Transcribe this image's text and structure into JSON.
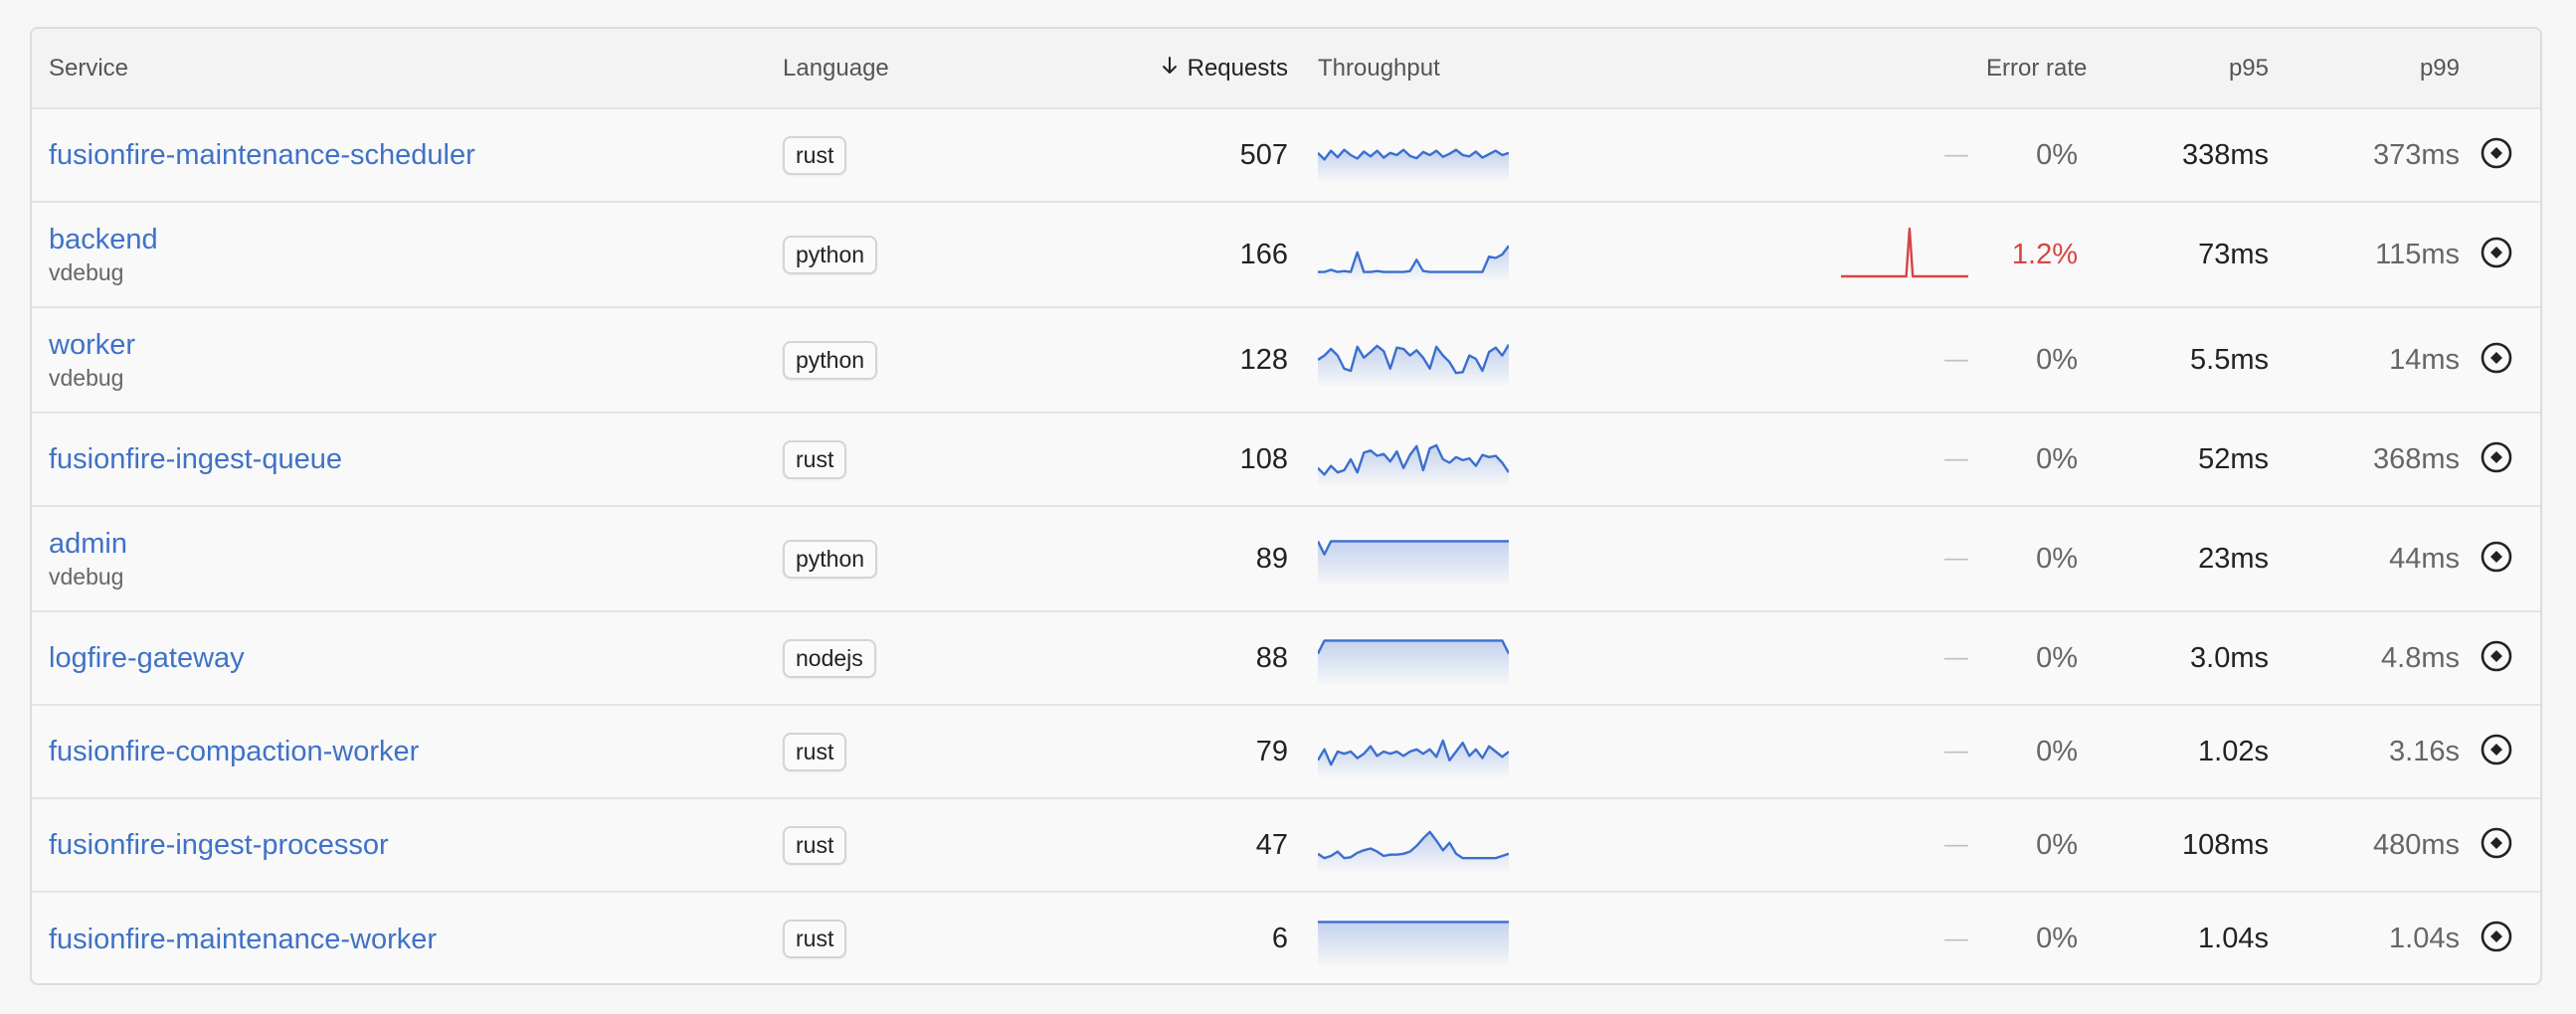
{
  "table": {
    "headers": {
      "service": "Service",
      "language": "Language",
      "requests": "Requests",
      "throughput": "Throughput",
      "error_rate": "Error rate",
      "p95": "p95",
      "p99": "p99"
    },
    "sort": {
      "column": "requests",
      "direction": "descending",
      "icon": "arrow-down-icon"
    },
    "colors": {
      "link": "#3f72c7",
      "sparkline": "#3b6fd0",
      "error": "#d64545"
    },
    "rows": [
      {
        "service": "fusionfire-maintenance-scheduler",
        "sub": "",
        "language": "rust",
        "requests": "507",
        "throughput": [
          0.55,
          0.4,
          0.6,
          0.45,
          0.62,
          0.5,
          0.42,
          0.58,
          0.47,
          0.6,
          0.44,
          0.55,
          0.5,
          0.62,
          0.48,
          0.43,
          0.57,
          0.5,
          0.6,
          0.46,
          0.53,
          0.62,
          0.5,
          0.47,
          0.58,
          0.44,
          0.52,
          0.6,
          0.5,
          0.55
        ],
        "error_rate": "0%",
        "error_spark": null,
        "p95": "338ms",
        "p99": "373ms"
      },
      {
        "service": "backend",
        "sub": "vdebug",
        "language": "python",
        "requests": "166",
        "throughput": [
          0.1,
          0.1,
          0.15,
          0.1,
          0.12,
          0.1,
          0.55,
          0.1,
          0.1,
          0.12,
          0.1,
          0.1,
          0.1,
          0.1,
          0.12,
          0.38,
          0.12,
          0.1,
          0.1,
          0.1,
          0.1,
          0.1,
          0.1,
          0.1,
          0.1,
          0.1,
          0.45,
          0.42,
          0.5,
          0.7
        ],
        "error_rate": "1.2%",
        "error_spark": [
          0,
          0,
          0,
          0,
          0,
          0,
          0,
          0,
          0,
          0,
          0,
          0,
          0,
          0,
          0,
          0,
          0,
          0,
          0,
          0,
          0,
          1,
          0,
          0,
          0,
          0,
          0,
          0,
          0,
          0,
          0,
          0,
          0,
          0,
          0,
          0,
          0,
          0,
          0,
          0
        ],
        "p95": "73ms",
        "p99": "115ms"
      },
      {
        "service": "worker",
        "sub": "vdebug",
        "language": "python",
        "requests": "128",
        "throughput": [
          0.5,
          0.6,
          0.75,
          0.6,
          0.3,
          0.25,
          0.8,
          0.55,
          0.68,
          0.82,
          0.7,
          0.3,
          0.78,
          0.75,
          0.6,
          0.72,
          0.55,
          0.3,
          0.8,
          0.6,
          0.45,
          0.2,
          0.22,
          0.6,
          0.52,
          0.25,
          0.68,
          0.78,
          0.6,
          0.85
        ],
        "error_rate": "0%",
        "error_spark": null,
        "p95": "5.5ms",
        "p99": "14ms"
      },
      {
        "service": "fusionfire-ingest-queue",
        "sub": "",
        "language": "rust",
        "requests": "108",
        "throughput": [
          0.3,
          0.15,
          0.35,
          0.2,
          0.25,
          0.5,
          0.2,
          0.65,
          0.7,
          0.58,
          0.62,
          0.45,
          0.68,
          0.3,
          0.6,
          0.8,
          0.25,
          0.75,
          0.82,
          0.5,
          0.42,
          0.55,
          0.48,
          0.52,
          0.35,
          0.6,
          0.55,
          0.58,
          0.42,
          0.2
        ],
        "error_rate": "0%",
        "error_spark": null,
        "p95": "52ms",
        "p99": "368ms"
      },
      {
        "service": "admin",
        "sub": "vdebug",
        "language": "python",
        "requests": "89",
        "throughput": [
          0.9,
          0.6,
          0.9,
          0.9,
          0.9,
          0.9,
          0.9,
          0.9,
          0.9,
          0.9,
          0.9,
          0.9,
          0.9,
          0.9,
          0.9,
          0.9,
          0.9,
          0.9,
          0.9,
          0.9,
          0.9,
          0.9,
          0.9,
          0.9,
          0.9,
          0.9,
          0.9,
          0.9,
          0.9,
          0.9
        ],
        "error_rate": "0%",
        "error_spark": null,
        "p95": "23ms",
        "p99": "44ms"
      },
      {
        "service": "logfire-gateway",
        "sub": "",
        "language": "nodejs",
        "requests": "88",
        "throughput": [
          0.6,
          0.9,
          0.9,
          0.9,
          0.9,
          0.9,
          0.9,
          0.9,
          0.9,
          0.9,
          0.9,
          0.9,
          0.9,
          0.9,
          0.9,
          0.9,
          0.9,
          0.9,
          0.9,
          0.9,
          0.9,
          0.9,
          0.9,
          0.9,
          0.9,
          0.9,
          0.9,
          0.9,
          0.9,
          0.6
        ],
        "error_rate": "0%",
        "error_spark": null,
        "p95": "3.0ms",
        "p99": "4.8ms"
      },
      {
        "service": "fusionfire-compaction-worker",
        "sub": "",
        "language": "rust",
        "requests": "79",
        "throughput": [
          0.3,
          0.55,
          0.2,
          0.5,
          0.45,
          0.5,
          0.35,
          0.45,
          0.62,
          0.4,
          0.5,
          0.45,
          0.5,
          0.4,
          0.5,
          0.55,
          0.45,
          0.55,
          0.38,
          0.75,
          0.3,
          0.5,
          0.7,
          0.4,
          0.55,
          0.35,
          0.62,
          0.5,
          0.38,
          0.5
        ],
        "error_rate": "0%",
        "error_spark": null,
        "p95": "1.02s",
        "p99": "3.16s"
      },
      {
        "service": "fusionfire-ingest-processor",
        "sub": "",
        "language": "rust",
        "requests": "47",
        "throughput": [
          0.3,
          0.2,
          0.25,
          0.35,
          0.2,
          0.22,
          0.32,
          0.38,
          0.42,
          0.35,
          0.25,
          0.28,
          0.28,
          0.3,
          0.35,
          0.48,
          0.65,
          0.8,
          0.6,
          0.38,
          0.55,
          0.3,
          0.2,
          0.2,
          0.2,
          0.2,
          0.2,
          0.2,
          0.25,
          0.3
        ],
        "error_rate": "0%",
        "error_spark": null,
        "p95": "108ms",
        "p99": "480ms"
      },
      {
        "service": "fusionfire-maintenance-worker",
        "sub": "",
        "language": "rust",
        "requests": "6",
        "throughput": [
          0.9,
          0.9,
          0.9,
          0.9,
          0.9,
          0.9,
          0.9,
          0.9,
          0.9,
          0.9,
          0.9,
          0.9,
          0.9,
          0.9,
          0.9,
          0.9,
          0.9,
          0.9,
          0.9,
          0.9,
          0.9,
          0.9,
          0.9,
          0.9,
          0.9,
          0.9,
          0.9,
          0.9,
          0.9,
          0.9
        ],
        "error_rate": "0%",
        "error_spark": null,
        "p95": "1.04s",
        "p99": "1.04s"
      }
    ],
    "row_actions": {
      "first_icon": "target-icon",
      "second_icon": "line-chart-icon"
    },
    "no_error_placeholder": "—"
  }
}
